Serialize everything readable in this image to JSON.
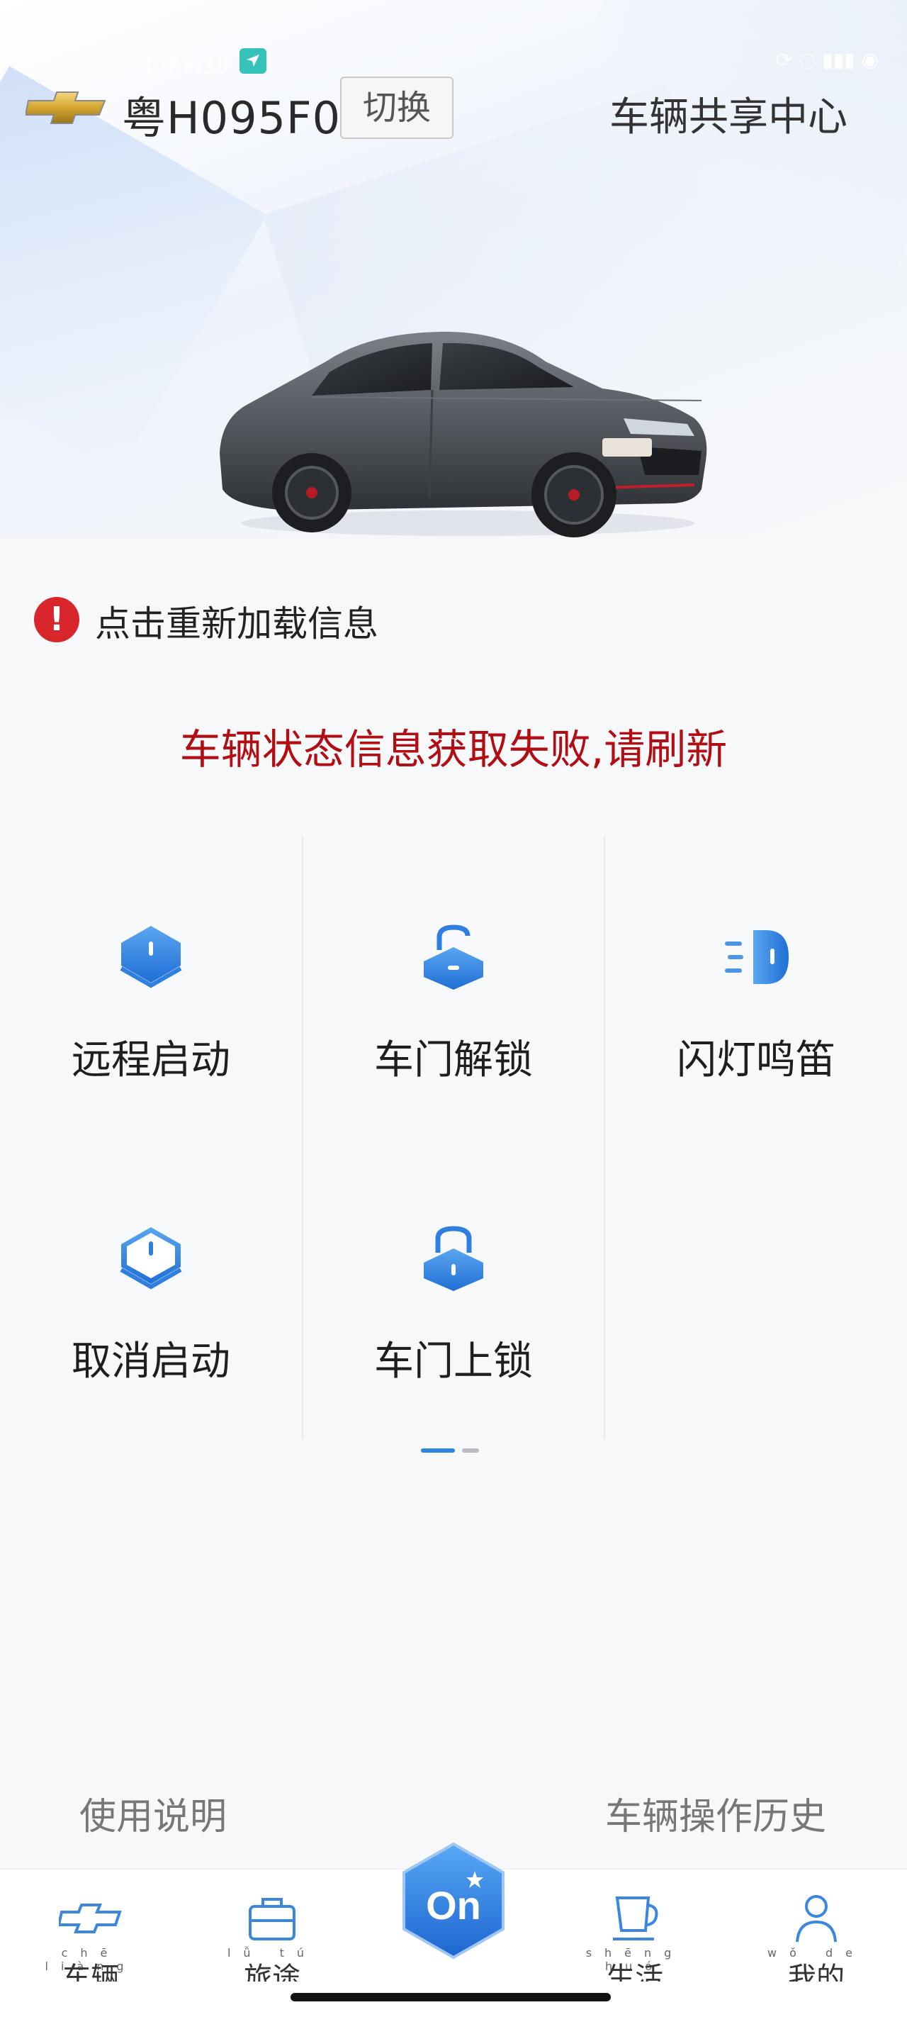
{
  "status_bar": {
    "time": "上午9:39",
    "indicators": "⟳ ◌ ▮▮▮ ◉"
  },
  "header": {
    "brand": "chevrolet-bowtie",
    "plate": "粤H095F0",
    "switch_label": "切换",
    "share_center_label": "车辆共享中心"
  },
  "reload": {
    "icon": "alert-icon",
    "text": "点击重新加载信息"
  },
  "error_message": "车辆状态信息获取失败,请刷新",
  "controls": [
    {
      "label": "远程启动",
      "icon": "remote-start-icon"
    },
    {
      "label": "车门解锁",
      "icon": "unlock-icon"
    },
    {
      "label": "闪灯鸣笛",
      "icon": "flash-horn-icon"
    },
    {
      "label": "取消启动",
      "icon": "cancel-start-icon"
    },
    {
      "label": "车门上锁",
      "icon": "lock-icon"
    }
  ],
  "pager": {
    "pages": 2,
    "active": 1
  },
  "links": {
    "help": "使用说明",
    "history": "车辆操作历史"
  },
  "tabbar": {
    "tabs": [
      {
        "label": "车辆",
        "pinyin": "chē liàng",
        "icon": "car-icon"
      },
      {
        "label": "旅途",
        "pinyin": "lǚ tú",
        "icon": "briefcase-icon"
      },
      {
        "label": "On",
        "icon": "onstar-icon"
      },
      {
        "label": "生活",
        "pinyin": "shēng huó",
        "icon": "cup-icon"
      },
      {
        "label": "我的",
        "pinyin": "wǒ de",
        "icon": "user-icon"
      }
    ]
  },
  "colors": {
    "accent": "#2a86e0",
    "error": "#b30d14",
    "alert": "#d9252c",
    "brand_gold": "#d4a533"
  }
}
